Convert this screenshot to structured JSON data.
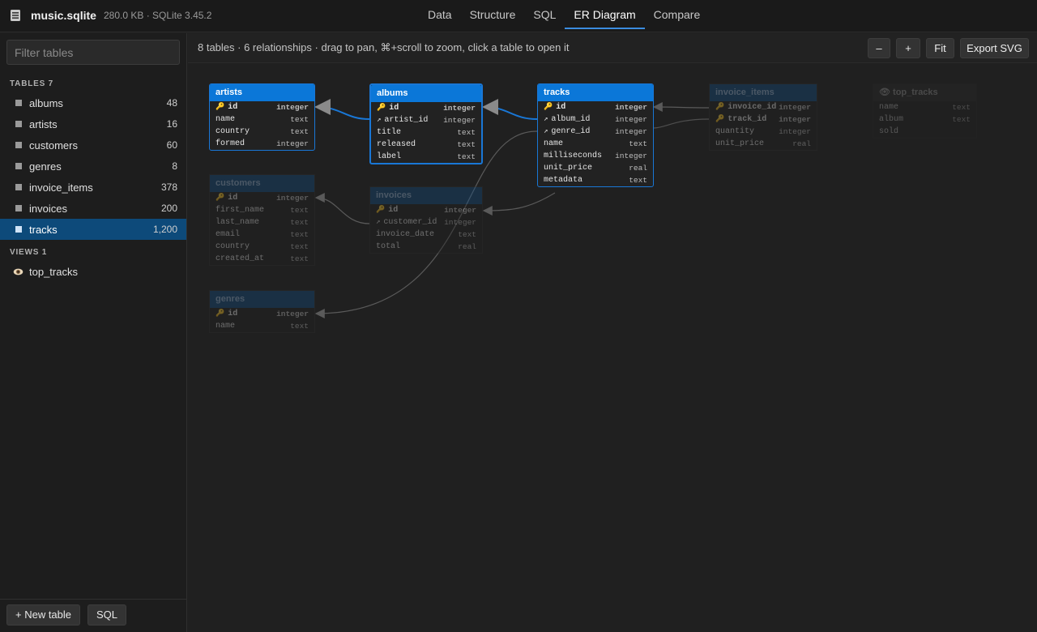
{
  "file": {
    "name": "music.sqlite",
    "meta": "280.0 KB · SQLite 3.45.2"
  },
  "tabs": [
    {
      "label": "Data"
    },
    {
      "label": "Structure"
    },
    {
      "label": "SQL"
    },
    {
      "label": "ER Diagram"
    },
    {
      "label": "Compare"
    }
  ],
  "sidebar": {
    "filter_placeholder": "Filter tables",
    "tables_label": "TABLES 7",
    "tables": [
      {
        "name": "albums",
        "count": "48"
      },
      {
        "name": "artists",
        "count": "16"
      },
      {
        "name": "customers",
        "count": "60"
      },
      {
        "name": "genres",
        "count": "8"
      },
      {
        "name": "invoice_items",
        "count": "378"
      },
      {
        "name": "invoices",
        "count": "200"
      },
      {
        "name": "tracks",
        "count": "1,200"
      }
    ],
    "views_label": "VIEWS 1",
    "views": [
      {
        "name": "top_tracks"
      }
    ],
    "new_table_label": "+ New table",
    "sql_label": "SQL"
  },
  "toolbar": {
    "hint": "8 tables · 6 relationships · drag to pan, ⌘+scroll to zoom, click a table to open it",
    "zoom_out": "–",
    "zoom_in": "+",
    "fit": "Fit",
    "export": "Export SVG"
  },
  "er": {
    "artists": {
      "title": "artists",
      "cols": [
        {
          "name": "id",
          "type": "integer",
          "key": "pk"
        },
        {
          "name": "name",
          "type": "text"
        },
        {
          "name": "country",
          "type": "text"
        },
        {
          "name": "formed",
          "type": "integer"
        }
      ]
    },
    "albums": {
      "title": "albums",
      "cols": [
        {
          "name": "id",
          "type": "integer",
          "key": "pk"
        },
        {
          "name": "artist_id",
          "type": "integer",
          "key": "fk"
        },
        {
          "name": "title",
          "type": "text"
        },
        {
          "name": "released",
          "type": "text"
        },
        {
          "name": "label",
          "type": "text"
        }
      ]
    },
    "tracks": {
      "title": "tracks",
      "cols": [
        {
          "name": "id",
          "type": "integer",
          "key": "pk"
        },
        {
          "name": "album_id",
          "type": "integer",
          "key": "fk"
        },
        {
          "name": "genre_id",
          "type": "integer",
          "key": "fk"
        },
        {
          "name": "name",
          "type": "text"
        },
        {
          "name": "milliseconds",
          "type": "integer"
        },
        {
          "name": "unit_price",
          "type": "real"
        },
        {
          "name": "metadata",
          "type": "text"
        }
      ]
    },
    "invoice_items": {
      "title": "invoice_items",
      "cols": [
        {
          "name": "invoice_id",
          "type": "integer",
          "key": "pk"
        },
        {
          "name": "track_id",
          "type": "integer",
          "key": "pk"
        },
        {
          "name": "quantity",
          "type": "integer"
        },
        {
          "name": "unit_price",
          "type": "real"
        }
      ]
    },
    "top_tracks": {
      "title": "top_tracks",
      "cols": [
        {
          "name": "name",
          "type": "text"
        },
        {
          "name": "album",
          "type": "text"
        },
        {
          "name": "sold",
          "type": ""
        }
      ]
    },
    "customers": {
      "title": "customers",
      "cols": [
        {
          "name": "id",
          "type": "integer",
          "key": "pk"
        },
        {
          "name": "first_name",
          "type": "text"
        },
        {
          "name": "last_name",
          "type": "text"
        },
        {
          "name": "email",
          "type": "text"
        },
        {
          "name": "country",
          "type": "text"
        },
        {
          "name": "created_at",
          "type": "text"
        }
      ]
    },
    "invoices": {
      "title": "invoices",
      "cols": [
        {
          "name": "id",
          "type": "integer",
          "key": "pk"
        },
        {
          "name": "customer_id",
          "type": "integer",
          "key": "fk"
        },
        {
          "name": "invoice_date",
          "type": "text"
        },
        {
          "name": "total",
          "type": "real"
        }
      ]
    },
    "genres": {
      "title": "genres",
      "cols": [
        {
          "name": "id",
          "type": "integer",
          "key": "pk"
        },
        {
          "name": "name",
          "type": "text"
        }
      ]
    }
  },
  "colors": {
    "accent": "#0b77d8",
    "selected": "#0d4a7a"
  }
}
